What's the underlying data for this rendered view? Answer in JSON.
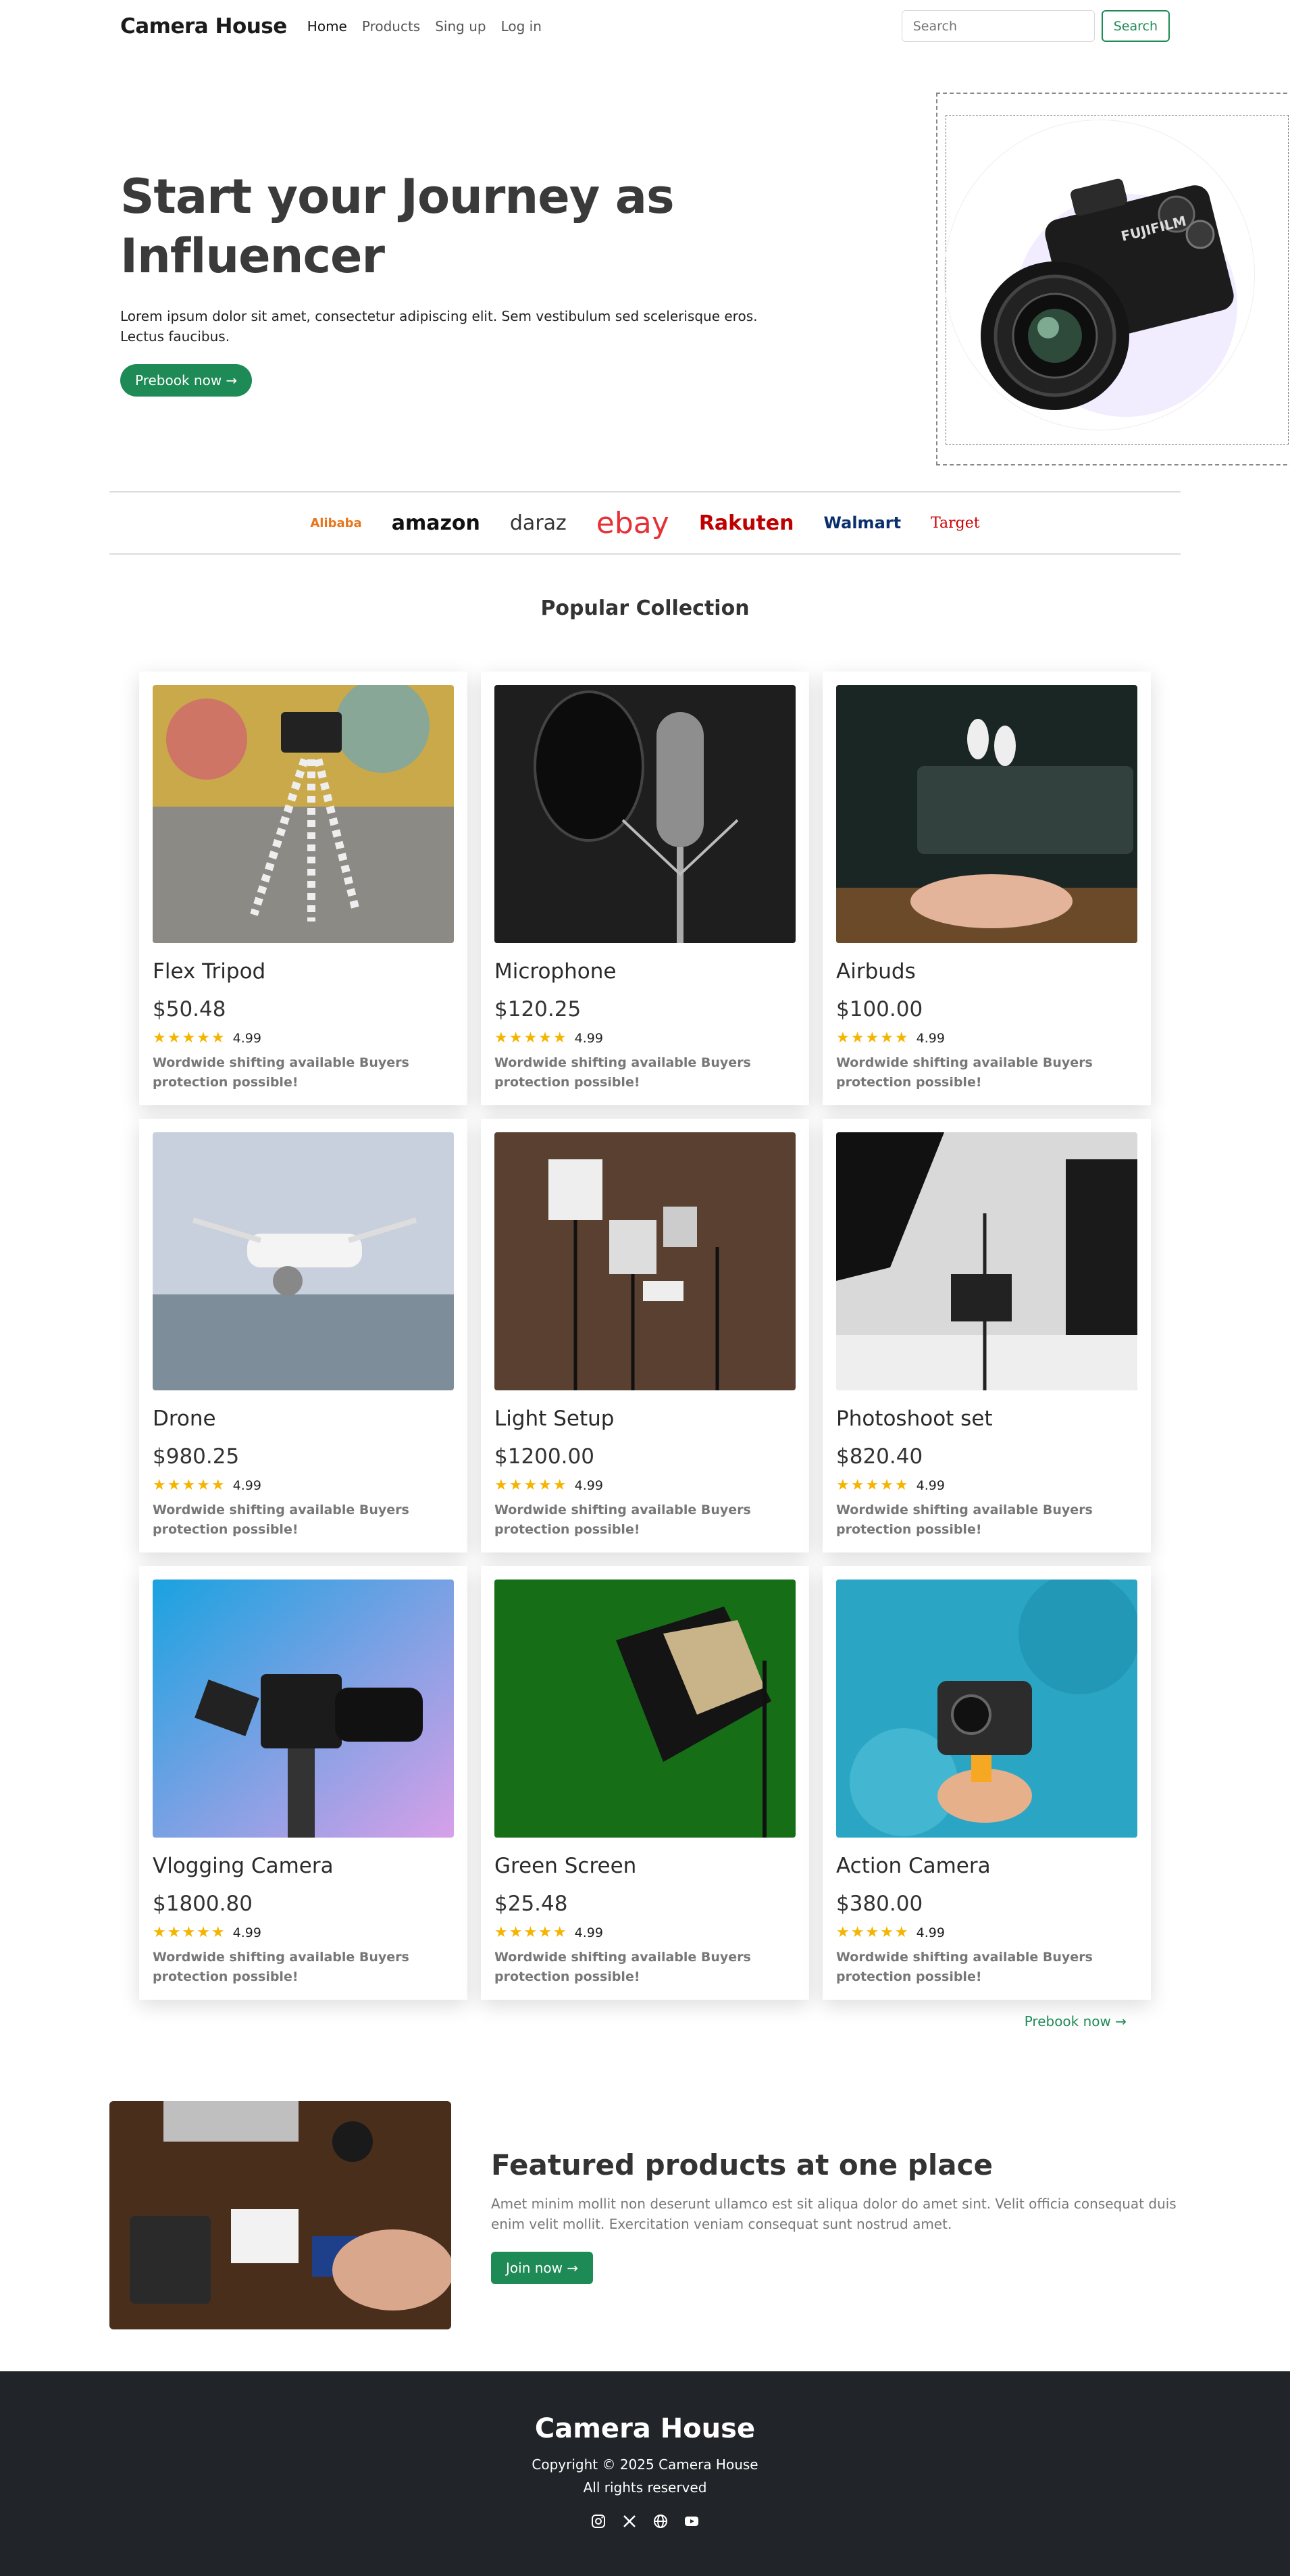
{
  "nav": {
    "brand": "Camera House",
    "links": [
      "Home",
      "Products",
      "Sing up",
      "Log in"
    ],
    "search_placeholder": "Search",
    "search_button": "Search"
  },
  "hero": {
    "title": "Start your Journey as Influencer",
    "description": "Lorem ipsum dolor sit amet, consectetur adipiscing elit. Sem vestibulum sed scelerisque eros. Lectus faucibus.",
    "cta": "Prebook now →",
    "camera_brand": "FUJIFILM"
  },
  "brands": [
    "Alibaba",
    "amazon",
    "daraz",
    "ebay",
    "Rakuten",
    "Walmart",
    "Target"
  ],
  "collection": {
    "title": "Popular Collection",
    "products": [
      {
        "name": "Flex Tripod",
        "price": "$50.48",
        "stars": "★★★★★",
        "rating": "4.99",
        "note": "Wordwide shifting available Buyers protection possible!"
      },
      {
        "name": "Microphone",
        "price": "$120.25",
        "stars": "★★★★★",
        "rating": "4.99",
        "note": "Wordwide shifting available Buyers protection possible!"
      },
      {
        "name": "Airbuds",
        "price": "$100.00",
        "stars": "★★★★★",
        "rating": "4.99",
        "note": "Wordwide shifting available Buyers protection possible!"
      },
      {
        "name": "Drone",
        "price": "$980.25",
        "stars": "★★★★★",
        "rating": "4.99",
        "note": "Wordwide shifting available Buyers protection possible!"
      },
      {
        "name": "Light Setup",
        "price": "$1200.00",
        "stars": "★★★★★",
        "rating": "4.99",
        "note": "Wordwide shifting available Buyers protection possible!"
      },
      {
        "name": "Photoshoot set",
        "price": "$820.40",
        "stars": "★★★★★",
        "rating": "4.99",
        "note": "Wordwide shifting available Buyers protection possible!"
      },
      {
        "name": "Vlogging Camera",
        "price": "$1800.80",
        "stars": "★★★★★",
        "rating": "4.99",
        "note": "Wordwide shifting available Buyers protection possible!"
      },
      {
        "name": "Green Screen",
        "price": "$25.48",
        "stars": "★★★★★",
        "rating": "4.99",
        "note": "Wordwide shifting available Buyers protection possible!"
      },
      {
        "name": "Action Camera",
        "price": "$380.00",
        "stars": "★★★★★",
        "rating": "4.99",
        "note": "Wordwide shifting available Buyers protection possible!"
      }
    ],
    "more_link": "Prebook now →"
  },
  "featured": {
    "title": "Featured products at one place",
    "description": "Amet minim mollit non deserunt ullamco est sit aliqua dolor do amet sint. Velit officia consequat duis enim velit mollit. Exercitation veniam consequat sunt nostrud amet.",
    "cta": "Join now →"
  },
  "footer": {
    "brand": "Camera House",
    "copyright": "Copyright © 2025 Camera House",
    "rights": "All rights reserved",
    "socials": [
      "instagram-icon",
      "x-icon",
      "globe-icon",
      "youtube-icon"
    ]
  },
  "colors": {
    "accent": "#1e8a55",
    "footer_bg": "#212529",
    "star": "#f5b400"
  }
}
